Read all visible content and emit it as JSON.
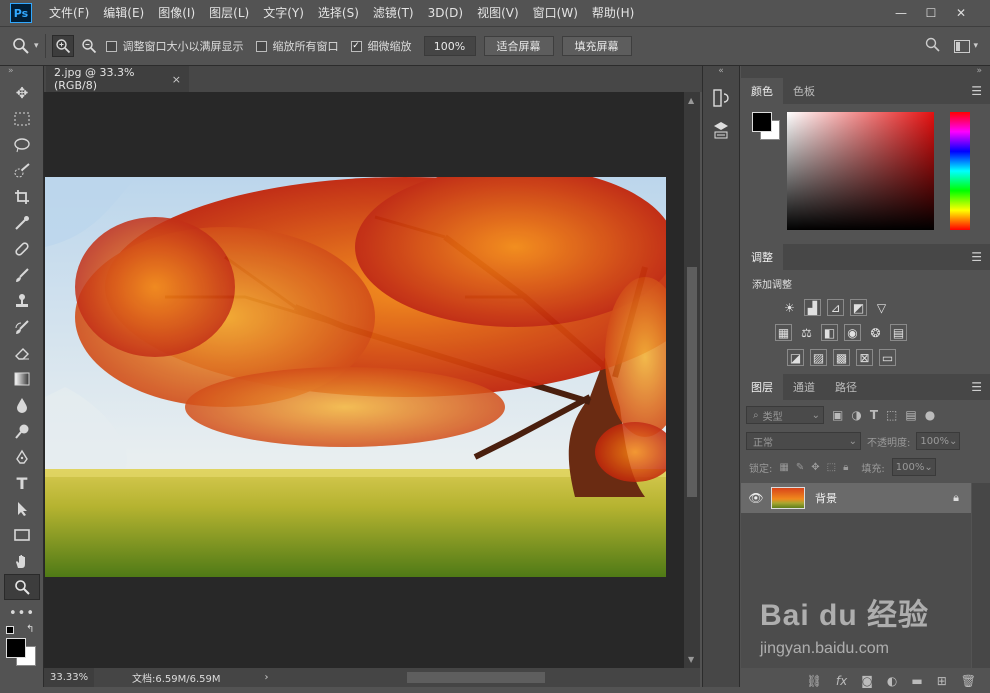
{
  "app": {
    "logo": "Ps"
  },
  "menu": {
    "items": [
      "文件(F)",
      "编辑(E)",
      "图像(I)",
      "图层(L)",
      "文字(Y)",
      "选择(S)",
      "滤镜(T)",
      "3D(D)",
      "视图(V)",
      "窗口(W)",
      "帮助(H)"
    ]
  },
  "window_controls": {
    "minimize": "—",
    "maximize": "☐",
    "close": "✕"
  },
  "options": {
    "resize_windows_label": "调整窗口大小以满屏显示",
    "resize_windows_checked": false,
    "zoom_all_label": "缩放所有窗口",
    "zoom_all_checked": false,
    "scrubby_zoom_label": "细微缩放",
    "scrubby_zoom_checked": true,
    "zoom_value": "100%",
    "fit_screen_label": "适合屏幕",
    "fill_screen_label": "填充屏幕"
  },
  "document": {
    "tab_title": "2.jpg @ 33.3%(RGB/8)",
    "close": "×"
  },
  "status": {
    "zoom": "33.33%",
    "doc_info": "文档:6.59M/6.59M",
    "arrow": "›"
  },
  "panels": {
    "color": {
      "tab_color": "颜色",
      "tab_swatches": "色板"
    },
    "adjustments": {
      "tab": "调整",
      "add_label": "添加调整"
    },
    "layers": {
      "tab_layers": "图层",
      "tab_channels": "通道",
      "tab_paths": "路径",
      "filter_kind": "类型",
      "blend_mode": "正常",
      "opacity_label": "不透明度:",
      "opacity_value": "100%",
      "lock_label": "锁定:",
      "fill_label": "填充:",
      "fill_value": "100%",
      "layer_name": "背景"
    }
  },
  "watermark": {
    "brand": "Bai du 经验",
    "url": "jingyan.baidu.com"
  },
  "colors": {
    "bg_panel": "#535353",
    "bg_canvas": "#282828",
    "accent": "#31a8ff",
    "foreground_color": "#000000",
    "background_color": "#ffffff"
  }
}
